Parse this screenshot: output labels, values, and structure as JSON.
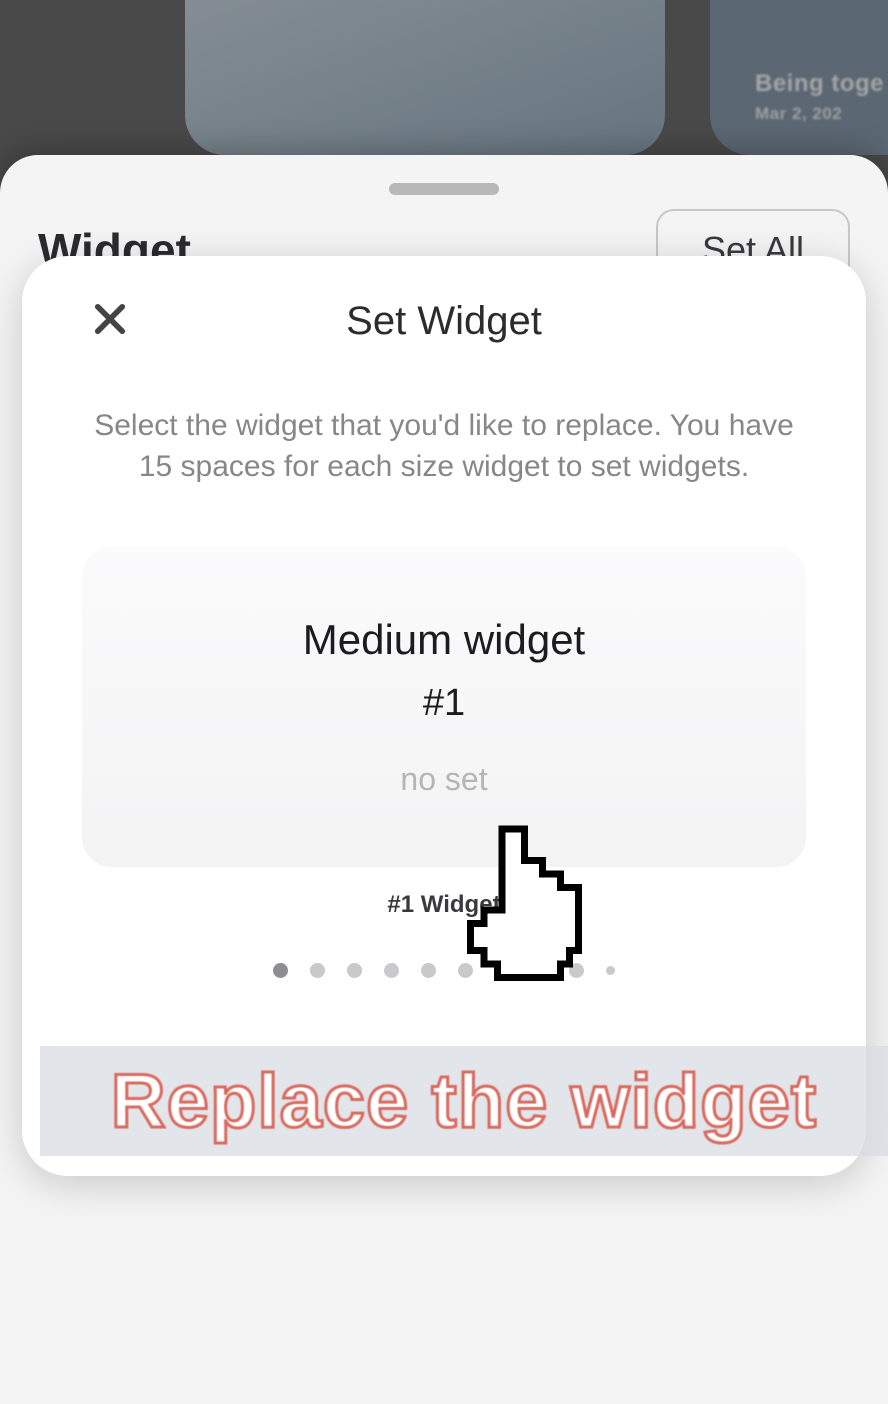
{
  "background": {
    "preview2_title": "Being toge",
    "preview2_date": "Mar 2, 202"
  },
  "sheet1": {
    "title": "Widget",
    "set_all_label": "Set All"
  },
  "modal": {
    "title": "Set Widget",
    "description": "Select the widget that you'd like to replace. You have 15 spaces for each size widget to set widgets.",
    "slot": {
      "size_label": "Medium widget",
      "number_label": "#1",
      "state": "no set",
      "caption": "#1 Widget"
    },
    "page_dots": {
      "count": 10,
      "active_index": 0
    }
  },
  "caption": "Replace the widget"
}
